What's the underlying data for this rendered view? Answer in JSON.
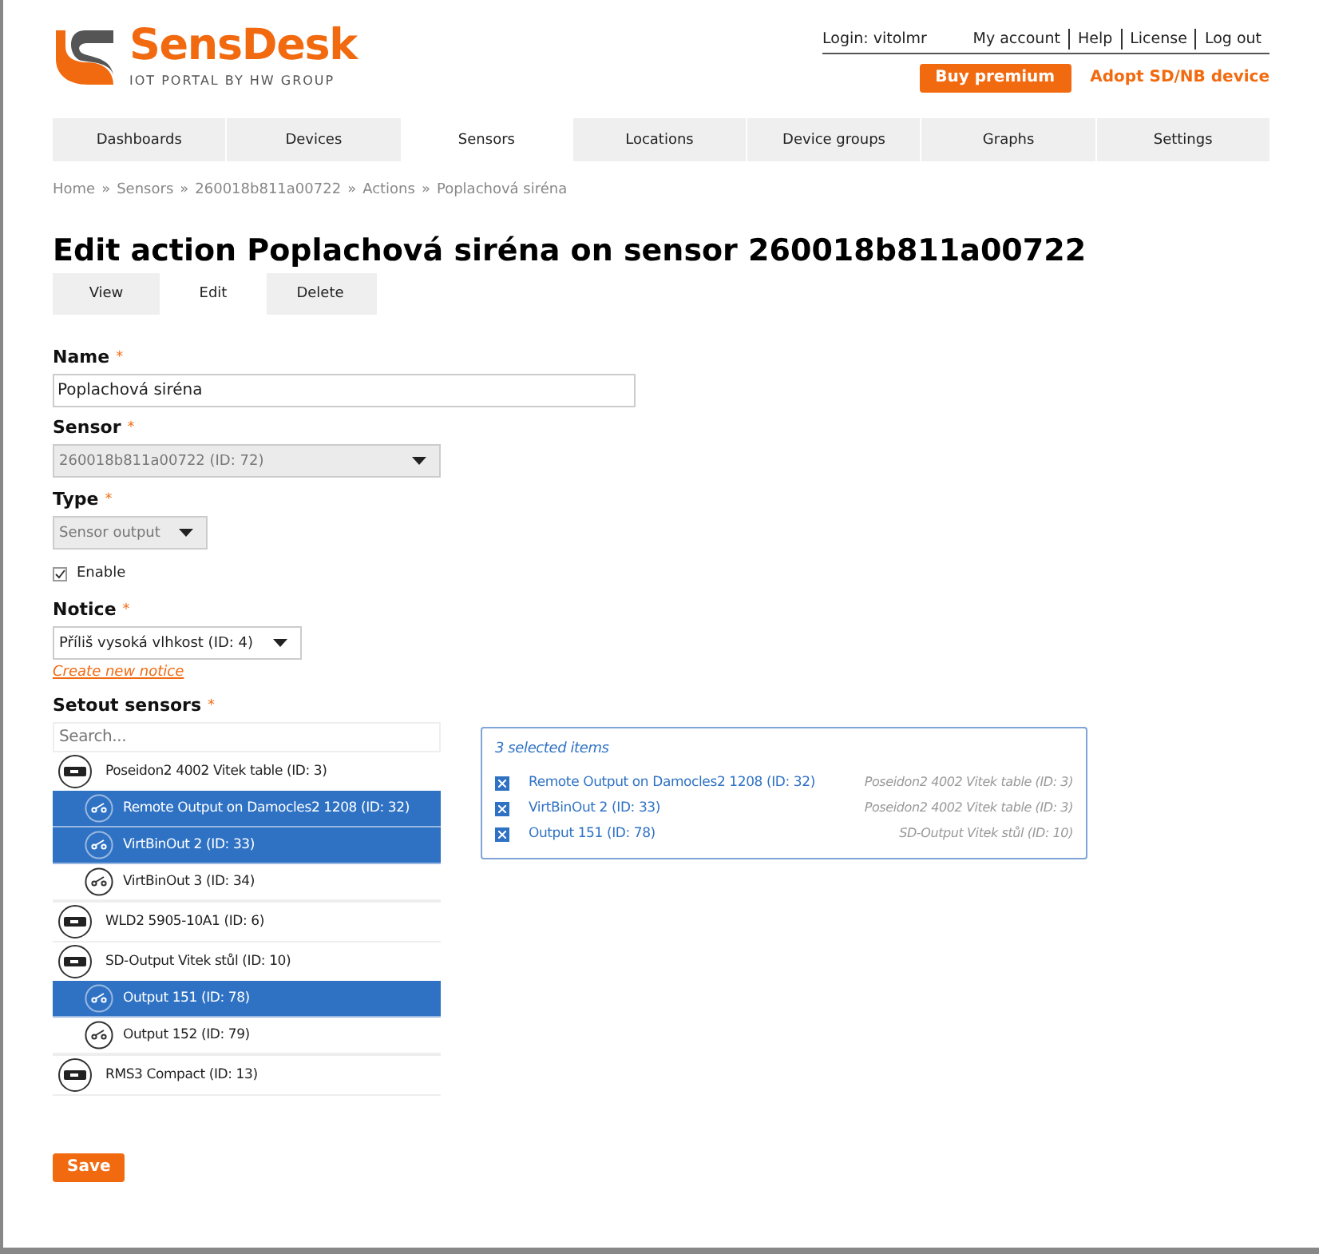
{
  "logo": {
    "name": "SensDesk",
    "tagline": "IOT PORTAL BY HW GROUP"
  },
  "user_bar": {
    "login": "Login: vitolmr",
    "links": [
      "My account",
      "Help",
      "License",
      "Log out"
    ]
  },
  "buy_button": "Buy premium",
  "adopt_link": "Adopt SD/NB device",
  "nav": [
    {
      "label": "Dashboards",
      "selected": false
    },
    {
      "label": "Devices",
      "selected": false
    },
    {
      "label": "Sensors",
      "selected": true
    },
    {
      "label": "Locations",
      "selected": false
    },
    {
      "label": "Device groups",
      "selected": false
    },
    {
      "label": "Graphs",
      "selected": false
    },
    {
      "label": "Settings",
      "selected": false
    }
  ],
  "breadcrumb": [
    "Home",
    "Sensors",
    "260018b811a00722",
    "Actions",
    "Poplachová siréna"
  ],
  "breadcrumb_separator": "»",
  "title": "Edit action Poplachová siréna on sensor 260018b811a00722",
  "tabs": [
    {
      "label": "View",
      "selected": false
    },
    {
      "label": "Edit",
      "selected": true
    },
    {
      "label": "Delete",
      "selected": false
    }
  ],
  "required_mark": "*",
  "form": {
    "name": {
      "label": "Name",
      "value": "Poplachová siréna"
    },
    "sensor": {
      "label": "Sensor",
      "value": "260018b811a00722 (ID: 72)",
      "disabled": true
    },
    "type": {
      "label": "Type",
      "value": "Sensor output",
      "disabled": true
    },
    "enable": {
      "label": "Enable",
      "checked": true
    },
    "notice": {
      "label": "Notice",
      "value": "Příliš vysoká vlhkost (ID: 4)",
      "disabled": false
    },
    "create_notice_link": "Create new notice"
  },
  "setout": {
    "label": "Setout sensors",
    "search_placeholder": "Search...",
    "tree": [
      {
        "label": "Poseidon2 4002 Vitek table (ID: 3)",
        "children": [
          {
            "label": "Remote Output on Damocles2 1208 (ID: 32)",
            "selected": true
          },
          {
            "label": "VirtBinOut 2 (ID: 33)",
            "selected": true
          },
          {
            "label": "VirtBinOut 3 (ID: 34)",
            "selected": false
          }
        ]
      },
      {
        "label": "WLD2 5905-10A1 (ID: 6)"
      },
      {
        "label": "SD-Output Vitek stůl (ID: 10)",
        "children": [
          {
            "label": "Output 151 (ID: 78)",
            "selected": true
          },
          {
            "label": "Output 152 (ID: 79)",
            "selected": false
          }
        ]
      },
      {
        "label": "RMS3 Compact (ID: 13)"
      }
    ],
    "selected_summary": "3 selected items",
    "selected_items": [
      {
        "label": "Remote Output on Damocles2 1208 (ID: 32)",
        "device": "Poseidon2 4002 Vitek table (ID: 3)"
      },
      {
        "label": "VirtBinOut 2 (ID: 33)",
        "device": "Poseidon2 4002 Vitek table (ID: 3)"
      },
      {
        "label": "Output 151 (ID: 78)",
        "device": "SD-Output Vitek stůl (ID: 10)"
      }
    ]
  },
  "save_button": "Save"
}
